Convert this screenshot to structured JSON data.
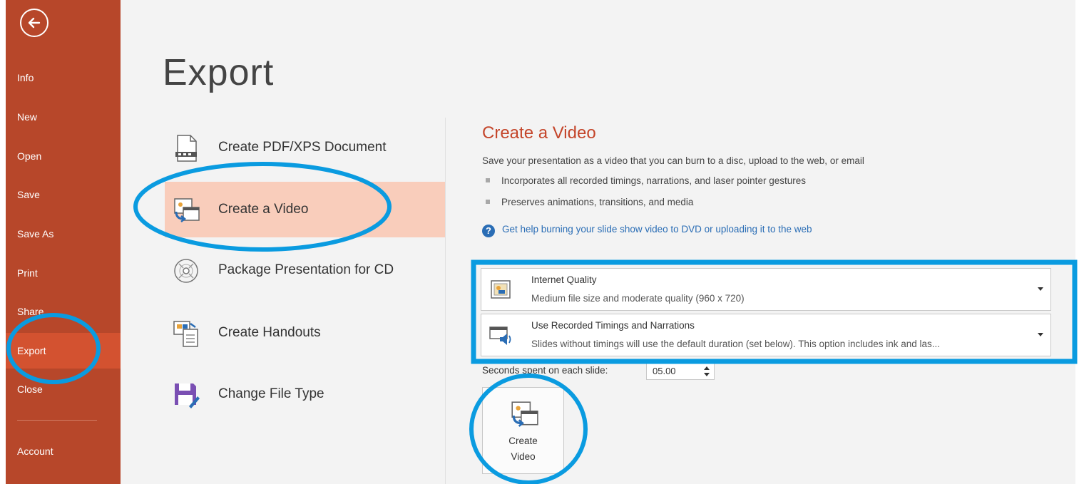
{
  "sidebar": {
    "back_icon": "back-arrow-icon",
    "items": [
      {
        "label": "Info"
      },
      {
        "label": "New"
      },
      {
        "label": "Open"
      },
      {
        "label": "Save"
      },
      {
        "label": "Save As"
      },
      {
        "label": "Print"
      },
      {
        "label": "Share"
      },
      {
        "label": "Export",
        "active": true
      },
      {
        "label": "Close"
      },
      {
        "label": "Account"
      }
    ]
  },
  "main": {
    "title": "Export",
    "options": [
      {
        "label": "Create PDF/XPS Document",
        "icon": "pdf-document-icon"
      },
      {
        "label": "Create a Video",
        "icon": "video-icon",
        "selected": true
      },
      {
        "label": "Package Presentation for CD",
        "icon": "cd-icon"
      },
      {
        "label": "Create Handouts",
        "icon": "handouts-icon"
      },
      {
        "label": "Change File Type",
        "icon": "save-file-type-icon"
      }
    ]
  },
  "panel": {
    "title": "Create a Video",
    "description": "Save your presentation as a video that you can burn to a disc, upload to the web, or email",
    "bullets": [
      "Incorporates all recorded timings, narrations, and laser pointer gestures",
      "Preserves animations, transitions, and media"
    ],
    "help_link": "Get help burning your slide show video to DVD or uploading it to the web",
    "quality": {
      "title": "Internet Quality",
      "subtitle": "Medium file size and moderate quality (960 x 720)"
    },
    "timings": {
      "title": "Use Recorded Timings and Narrations",
      "subtitle": "Slides without timings will use the default duration (set below). This option includes ink and las..."
    },
    "seconds_label": "Seconds spent on each slide:",
    "seconds_value": "05.00",
    "create_button": {
      "line1": "Create",
      "line2": "Video"
    }
  },
  "colors": {
    "backstage": "#b7472a",
    "backstage_active": "#d35230",
    "selected_option": "#f9cdbb",
    "panel_title": "#c4452a",
    "link": "#2a6db5",
    "annotation": "#0a9be0"
  }
}
